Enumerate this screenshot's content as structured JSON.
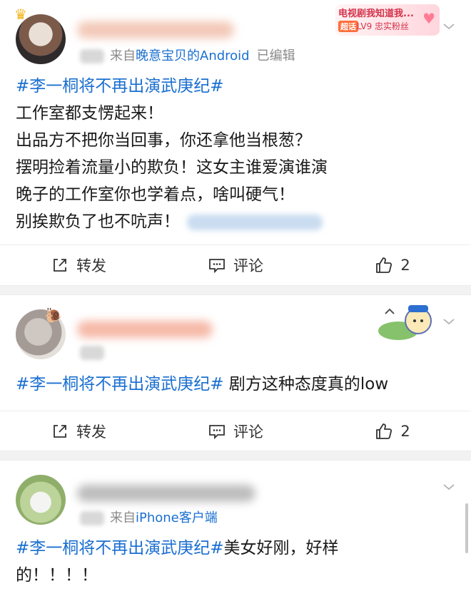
{
  "posts": [
    {
      "time_prefix": "刚刚",
      "source_prefix": "来自",
      "source_name": "晚意宝贝的Android",
      "edited": "已编辑",
      "badge": {
        "title": "电视剧我知道我...",
        "tag": "超话",
        "level": "LV9 忠实粉丝"
      },
      "topic": "#李一桐将不再出演武庚纪#",
      "lines": [
        "工作室都支愣起来！",
        "出品方不把你当回事，你还拿他当根葱？",
        "摆明捡着流量小的欺负！这女主谁爱演谁演",
        "晚子的工作室你也学着点，啥叫硬气！",
        "别挨欺负了也不吭声！"
      ],
      "actions": {
        "repost": "转发",
        "comment": "评论",
        "likes": "2"
      }
    },
    {
      "time_prefix": "刚刚",
      "topic": "#李一桐将不再出演武庚纪#",
      "text": " 剧方这种态度真的low",
      "actions": {
        "repost": "转发",
        "comment": "评论",
        "likes": "2"
      }
    },
    {
      "time_prefix": "刚刚",
      "source_prefix": "来自",
      "source_name": "iPhone客户端",
      "topic": "#李一桐将不再出演武庚纪#",
      "text_line1": "美女好刚，好样",
      "text_line2": "的！！！！"
    }
  ],
  "colors": {
    "link": "#1a6fd0",
    "meta": "#8a8a8a",
    "separator": "#f2f2f2"
  }
}
